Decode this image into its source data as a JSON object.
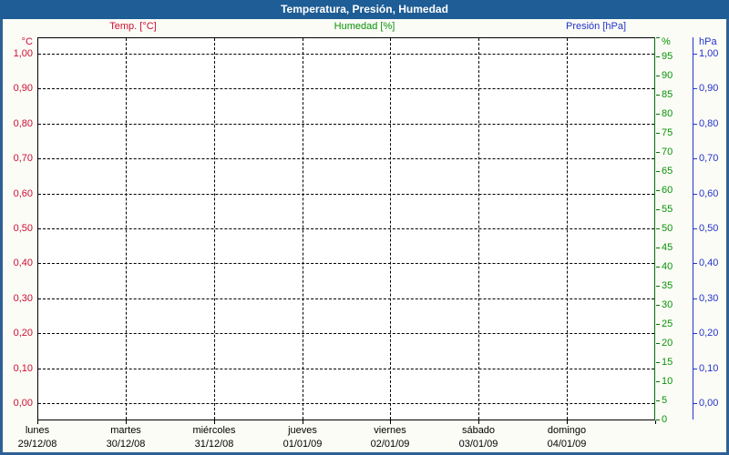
{
  "window": {
    "title": "Temperatura, Presión, Humedad"
  },
  "legend": {
    "items": [
      {
        "label": "Temp. [°C]",
        "color": "#cc0f34"
      },
      {
        "label": "Humedad [%]",
        "color": "#089208"
      },
      {
        "label": "Presión [hPa]",
        "color": "#2233cc"
      }
    ]
  },
  "axes": {
    "temperature": {
      "header": "°C",
      "color": "#cc0f34",
      "labels": [
        "1,00",
        "0,90",
        "0,80",
        "0,70",
        "0,60",
        "0,50",
        "0,40",
        "0,30",
        "0,20",
        "0,10",
        "0,00"
      ]
    },
    "humidity": {
      "header": "%",
      "color": "#089208",
      "line_color": "#077007",
      "labels": [
        "95",
        "90",
        "85",
        "80",
        "75",
        "70",
        "65",
        "60",
        "55",
        "50",
        "45",
        "40",
        "35",
        "30",
        "25",
        "20",
        "15",
        "10",
        "5",
        "0"
      ]
    },
    "pressure": {
      "header": "hPa",
      "color": "#2233cc",
      "labels": [
        "1,00",
        "0,90",
        "0,80",
        "0,70",
        "0,60",
        "0,50",
        "0,40",
        "0,30",
        "0,20",
        "0,10",
        "0,00"
      ]
    }
  },
  "x_axis": {
    "days": [
      {
        "name": "lunes",
        "date": "29/12/08"
      },
      {
        "name": "martes",
        "date": "30/12/08"
      },
      {
        "name": "miércoles",
        "date": "31/12/08"
      },
      {
        "name": "jueves",
        "date": "01/01/09"
      },
      {
        "name": "viernes",
        "date": "02/01/09"
      },
      {
        "name": "sábado",
        "date": "03/01/09"
      },
      {
        "name": "domingo",
        "date": "04/01/09"
      }
    ]
  },
  "colors": {
    "titlebar": "#1e5d95",
    "frame_border": "#2e6096",
    "temperature": "#cc0f34",
    "humidity": "#089208",
    "humidity_line": "#077007",
    "pressure": "#2233cc",
    "grid": "#000000",
    "background": "#fcfcf6"
  },
  "chart_data": {
    "type": "line",
    "title": "Temperatura, Presión, Humedad",
    "x": {
      "categories": [
        "lunes 29/12/08",
        "martes 30/12/08",
        "miércoles 31/12/08",
        "jueves 01/01/09",
        "viernes 02/01/09",
        "sábado 03/01/09",
        "domingo 04/01/09"
      ]
    },
    "axes": [
      {
        "name": "Temp. [°C]",
        "side": "left",
        "range": [
          0,
          1
        ],
        "tick_step": 0.1,
        "tick_labels": [
          "1,00",
          "0,90",
          "0,80",
          "0,70",
          "0,60",
          "0,50",
          "0,40",
          "0,30",
          "0,20",
          "0,10",
          "0,00"
        ]
      },
      {
        "name": "Humedad [%]",
        "side": "right",
        "range": [
          0,
          100
        ],
        "tick_step": 5
      },
      {
        "name": "Presión [hPa]",
        "side": "right-outer",
        "range": [
          0,
          1
        ],
        "tick_step": 0.1,
        "tick_labels": [
          "1,00",
          "0,90",
          "0,80",
          "0,70",
          "0,60",
          "0,50",
          "0,40",
          "0,30",
          "0,20",
          "0,10",
          "0,00"
        ]
      }
    ],
    "series": [
      {
        "name": "Temp. [°C]",
        "color": "#cc0f34",
        "values": []
      },
      {
        "name": "Humedad [%]",
        "color": "#089208",
        "values": []
      },
      {
        "name": "Presión [hPa]",
        "color": "#2233cc",
        "values": []
      }
    ],
    "grid": "black dashed; horizontal lines every 0.1 of left scale; vertical lines at each day boundary",
    "legend_position": "top"
  }
}
